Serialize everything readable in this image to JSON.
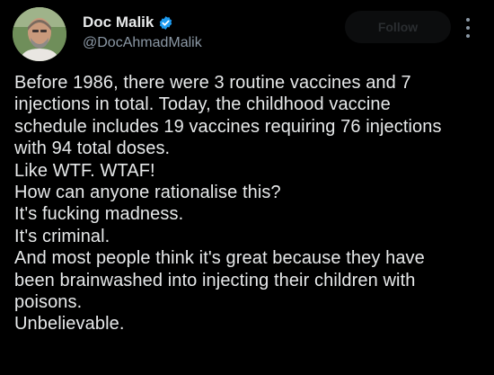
{
  "author": {
    "display_name": "Doc Malik",
    "handle": "@DocAhmadMalik",
    "verified": true,
    "avatar_icon": "profile-photo"
  },
  "header": {
    "follow_label": "Follow",
    "more_icon": "more-options-icon"
  },
  "tweet": {
    "lines": [
      "Before 1986, there were 3 routine vaccines and 7",
      "injections in total. Today, the childhood vaccine",
      "schedule includes 19 vaccines requiring 76 injections",
      "with 94 total doses.",
      "Like WTF. WTAF!",
      "How can anyone rationalise this?",
      "It's fucking madness.",
      "It's criminal.",
      "And most people think it's great because they have",
      "been brainwashed into injecting their children with",
      "poisons.",
      "Unbelievable."
    ]
  },
  "colors": {
    "background": "#000000",
    "text_primary": "#e7e9ea",
    "text_secondary": "#8b98a5",
    "verified_badge": "#1d9bf0"
  }
}
